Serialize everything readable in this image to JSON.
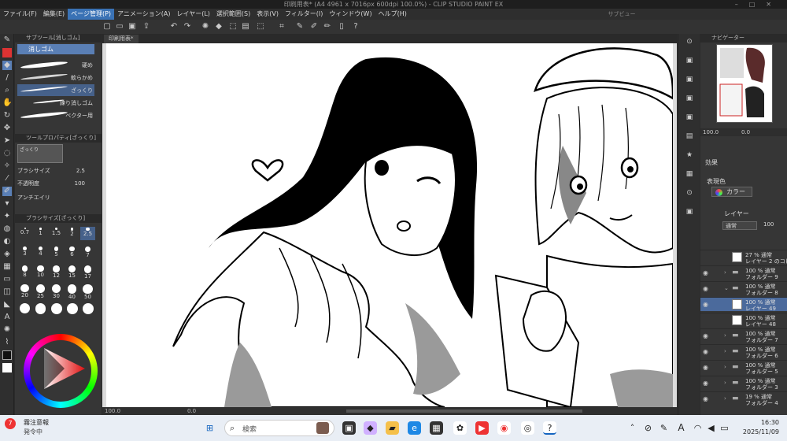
{
  "window": {
    "title": "印刷用表* (A4 4961 x 7016px 600dpi 100.0%) - CLIP STUDIO PAINT EX",
    "subview": "サブビュー"
  },
  "menu": [
    {
      "label": "ファイル(F)"
    },
    {
      "label": "編集(E)"
    },
    {
      "label": "ページ管理(P)",
      "active": true
    },
    {
      "label": "アニメーション(A)"
    },
    {
      "label": "レイヤー(L)"
    },
    {
      "label": "選択範囲(S)"
    },
    {
      "label": "表示(V)"
    },
    {
      "label": "フィルター(I)"
    },
    {
      "label": "ウィンドウ(W)"
    },
    {
      "label": "ヘルプ(H)"
    }
  ],
  "subtool": {
    "header": "サブツール[消しゴム]",
    "selected": "消しゴム",
    "brushes": [
      {
        "label": "硬め"
      },
      {
        "label": "軟らかめ"
      },
      {
        "label": "ざっくり",
        "selected": true
      },
      {
        "label": "練り消しゴム"
      },
      {
        "label": "ベクター用"
      }
    ]
  },
  "tool_property": {
    "header": "ツールプロパティ[ざっくり]",
    "preview_label": "ざっくり",
    "brush_size_label": "ブラシサイズ",
    "brush_size_value": "2.5",
    "opacity_label": "不透明度",
    "opacity_value": "100",
    "antialias_label": "アンチエイリ"
  },
  "brush_size_panel": {
    "header": "ブラシサイズ[ざっくり]",
    "sizes": [
      "0.7",
      "1",
      "1.5",
      "2",
      "2.5",
      "3",
      "4",
      "5",
      "6",
      "7",
      "8",
      "10",
      "12",
      "15",
      "17",
      "20",
      "25",
      "30",
      "40",
      "50",
      "",
      "",
      "",
      "",
      ""
    ]
  },
  "canvas": {
    "tab_label": "印刷用表*",
    "zoom": "100.0",
    "rotation": "0.0"
  },
  "navigator": {
    "header": "ナビゲーター",
    "zoom": "100.0",
    "rotation": "0.0"
  },
  "effect_panel": {
    "header": "効果",
    "color_label": "表現色",
    "color_value": "カラー"
  },
  "layer_panel": {
    "header": "レイヤー",
    "blend_mode": "通常",
    "opacity": "100",
    "layers": [
      {
        "line1": "27 % 通常",
        "line2": "レイヤー 2 のコピー",
        "kind": "layer",
        "visible": false
      },
      {
        "line1": "100 % 通常",
        "line2": "フォルダー 9",
        "kind": "folder",
        "visible": true
      },
      {
        "line1": "100 % 通常",
        "line2": "フォルダー 8",
        "kind": "folder",
        "visible": true,
        "expanded": true
      },
      {
        "line1": "100 % 通常",
        "line2": "レイヤー 49",
        "kind": "layer",
        "visible": true,
        "selected": true
      },
      {
        "line1": "100 % 通常",
        "line2": "レイヤー 48",
        "kind": "layer",
        "visible": false
      },
      {
        "line1": "100 % 通常",
        "line2": "フォルダー 7",
        "kind": "folder",
        "visible": true
      },
      {
        "line1": "100 % 通常",
        "line2": "フォルダー 6",
        "kind": "folder",
        "visible": true
      },
      {
        "line1": "100 % 通常",
        "line2": "フォルダー 5",
        "kind": "folder",
        "visible": true
      },
      {
        "line1": "100 % 通常",
        "line2": "フォルダー 3",
        "kind": "folder",
        "visible": true
      },
      {
        "line1": "19 % 通常",
        "line2": "フォルダー 4",
        "kind": "folder",
        "visible": true
      }
    ]
  },
  "taskbar": {
    "notify_badge": "7",
    "notify_title": "霧注意報",
    "notify_sub": "発令中",
    "search_placeholder": "検索",
    "ime_label": "A",
    "time": "16:30",
    "date": "2025/11/09"
  }
}
